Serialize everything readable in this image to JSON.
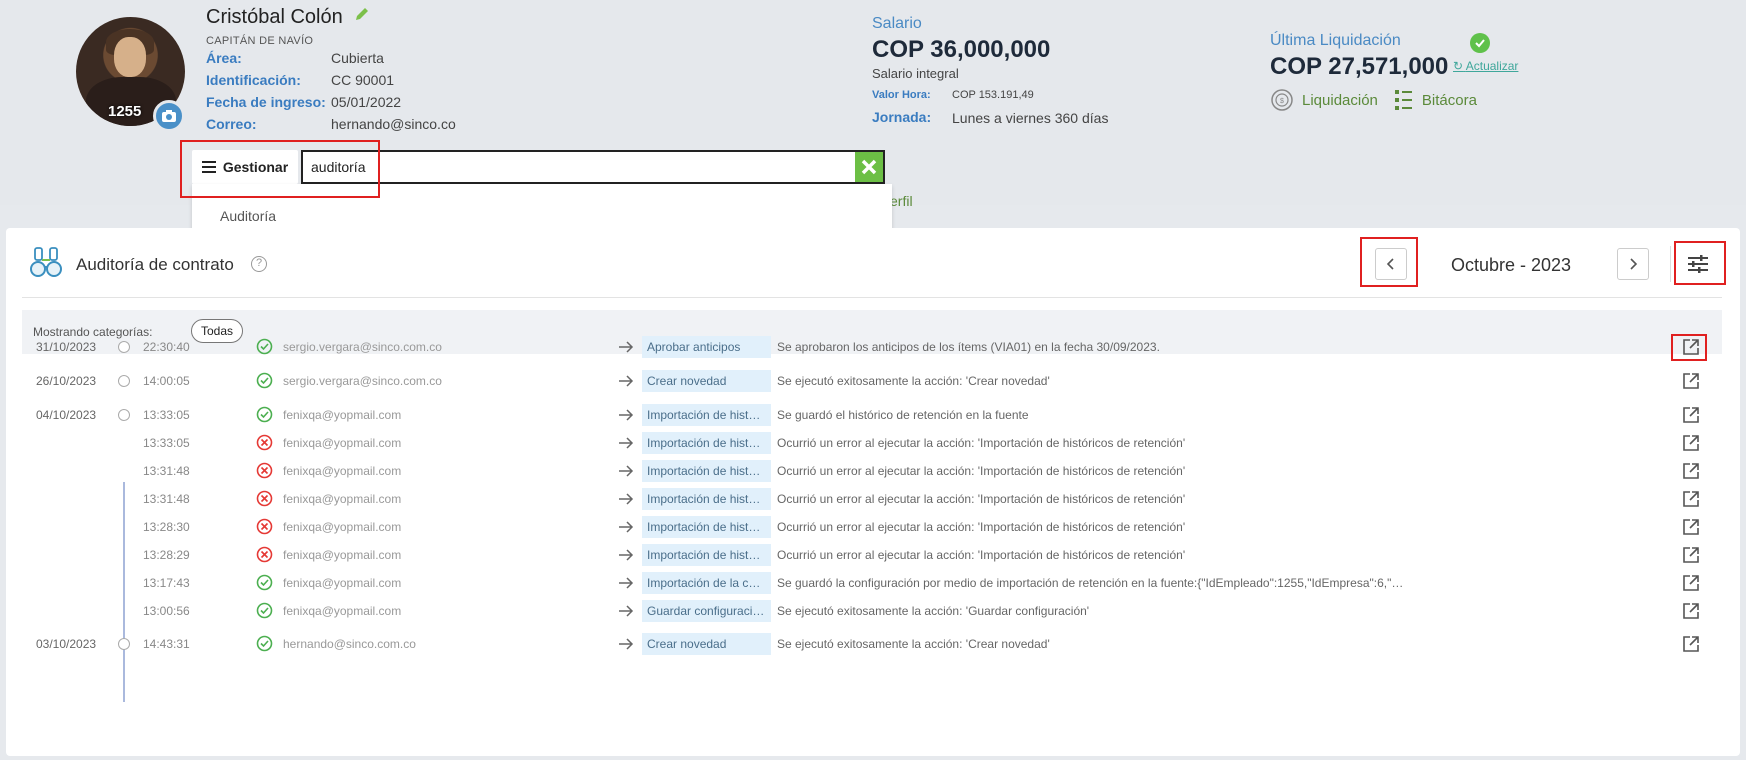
{
  "employee": {
    "name": "Cristóbal Colón",
    "role": "CAPITÁN DE NAVÍO",
    "number": "1255",
    "fields": [
      {
        "label": "Área:",
        "value": "Cubierta"
      },
      {
        "label": "Identificación:",
        "value": "CC 90001"
      },
      {
        "label": "Fecha de ingreso:",
        "value": "05/01/2022"
      },
      {
        "label": "Correo:",
        "value": "hernando@sinco.co"
      }
    ]
  },
  "salary": {
    "title": "Salario",
    "value": "COP 36,000,000",
    "sub": "Salario integral",
    "hour_label": "Valor Hora:",
    "hour_value": "COP 153.191,49",
    "schedule_label": "Jornada:",
    "schedule_value": "Lunes a viernes 360 días"
  },
  "settlement": {
    "title": "Última Liquidación",
    "value": "COP 27,571,000",
    "update_label": "Actualizar",
    "link1": "Liquidación",
    "link2": "Bitácora"
  },
  "manage": {
    "button_label": "Gestionar",
    "search_value": "auditoría",
    "option": "Auditoría",
    "tab_peek": "erfil"
  },
  "panel": {
    "title": "Auditoría de contrato",
    "month": "Octubre - 2023",
    "categories_label": "Mostrando categorías:",
    "categories_chip": "Todas"
  },
  "rows": [
    {
      "date": "31/10/2023",
      "time": "22:30:40",
      "status": "ok",
      "user": "sergio.vergara@sinco.com.co",
      "category": "Aprobar anticipos",
      "desc": "Se aprobaron los anticipos de los ítems (VIA01) en la fecha 30/09/2023."
    },
    {
      "date": "26/10/2023",
      "time": "14:00:05",
      "status": "ok",
      "user": "sergio.vergara@sinco.com.co",
      "category": "Crear novedad",
      "desc": "Se ejecutó exitosamente la acción: 'Crear novedad'"
    },
    {
      "date": "04/10/2023",
      "time": "13:33:05",
      "status": "ok",
      "user": "fenixqa@yopmail.com",
      "category": "Importación de hist…",
      "desc": "Se guardó el histórico de retención en la fuente"
    },
    {
      "date": "",
      "time": "13:33:05",
      "status": "error",
      "user": "fenixqa@yopmail.com",
      "category": "Importación de hist…",
      "desc": "Ocurrió un error al ejecutar la acción: 'Importación de históricos de retención'"
    },
    {
      "date": "",
      "time": "13:31:48",
      "status": "error",
      "user": "fenixqa@yopmail.com",
      "category": "Importación de hist…",
      "desc": "Ocurrió un error al ejecutar la acción: 'Importación de históricos de retención'"
    },
    {
      "date": "",
      "time": "13:31:48",
      "status": "error",
      "user": "fenixqa@yopmail.com",
      "category": "Importación de hist…",
      "desc": "Ocurrió un error al ejecutar la acción: 'Importación de históricos de retención'"
    },
    {
      "date": "",
      "time": "13:28:30",
      "status": "error",
      "user": "fenixqa@yopmail.com",
      "category": "Importación de hist…",
      "desc": "Ocurrió un error al ejecutar la acción: 'Importación de históricos de retención'"
    },
    {
      "date": "",
      "time": "13:28:29",
      "status": "error",
      "user": "fenixqa@yopmail.com",
      "category": "Importación de hist…",
      "desc": "Ocurrió un error al ejecutar la acción: 'Importación de históricos de retención'"
    },
    {
      "date": "",
      "time": "13:17:43",
      "status": "ok",
      "user": "fenixqa@yopmail.com",
      "category": "Importación de la c…",
      "desc": "Se guardó la configuración por medio de importación de retención en la fuente:{\"IdEmpleado\":1255,\"IdEmpresa\":6,\"…"
    },
    {
      "date": "",
      "time": "13:00:56",
      "status": "ok",
      "user": "fenixqa@yopmail.com",
      "category": "Guardar configuraci…",
      "desc": "Se ejecutó exitosamente la acción: 'Guardar configuración'"
    },
    {
      "date": "03/10/2023",
      "time": "14:43:31",
      "status": "ok",
      "user": "hernando@sinco.com.co",
      "category": "Crear novedad",
      "desc": "Se ejecutó exitosamente la acción: 'Crear novedad'"
    }
  ]
}
